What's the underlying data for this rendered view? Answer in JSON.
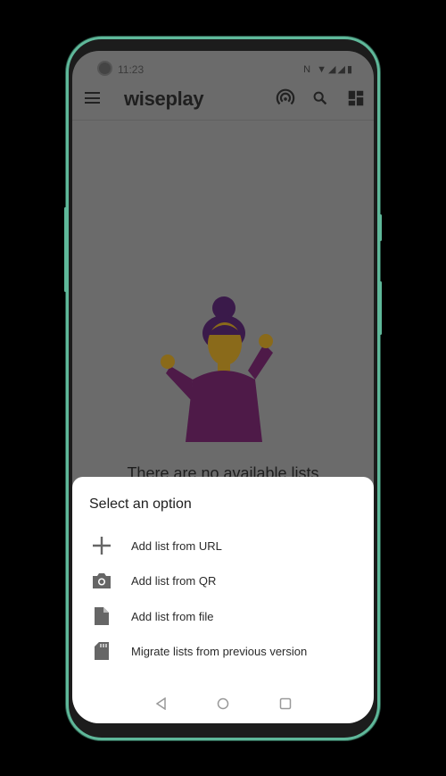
{
  "status": {
    "time": "11:23"
  },
  "appbar": {
    "title": "wiseplay"
  },
  "empty_message": "There are no available lists",
  "sheet": {
    "title": "Select an option",
    "items": [
      {
        "label": "Add list from URL",
        "icon": "plus-icon"
      },
      {
        "label": "Add list from QR",
        "icon": "camera-icon"
      },
      {
        "label": "Add list from file",
        "icon": "file-icon"
      },
      {
        "label": "Migrate lists from previous version",
        "icon": "sd-card-icon"
      }
    ]
  },
  "colors": {
    "frame": "#5fb89a",
    "scrim": "#6b6b6b",
    "shirt": "#7a2a6a"
  }
}
